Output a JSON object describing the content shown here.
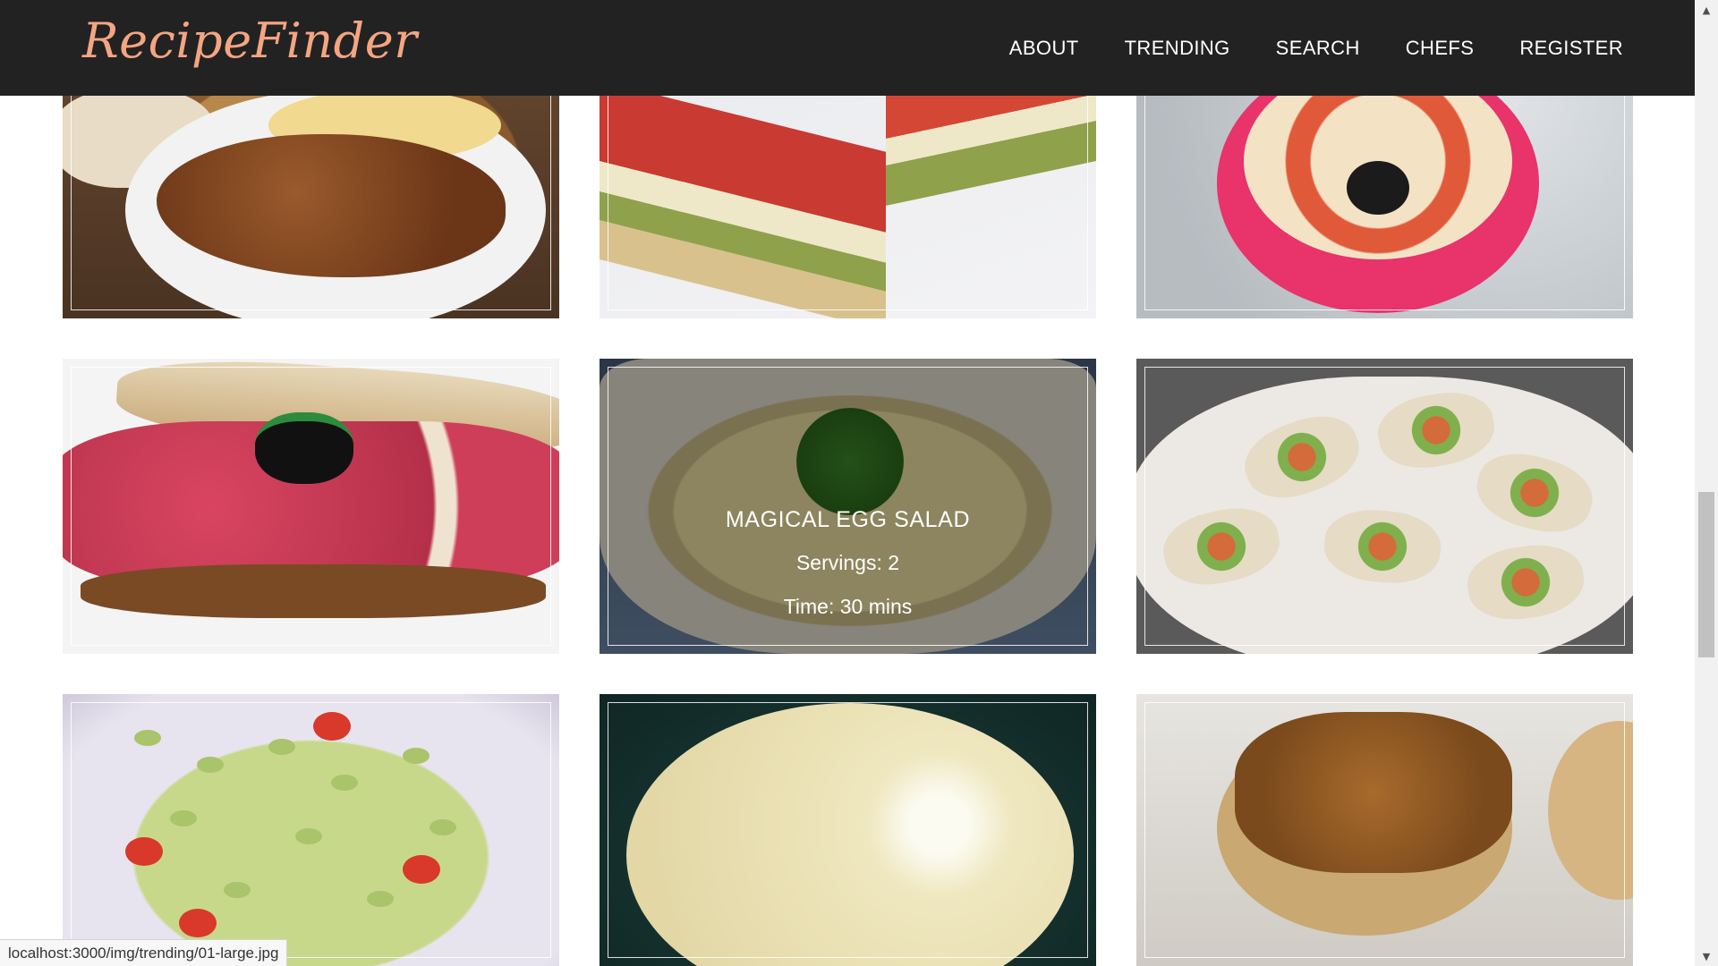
{
  "navbar": {
    "brand": "RecipeFinder",
    "links": [
      "ABOUT",
      "TRENDING",
      "SEARCH",
      "CHEFS",
      "REGISTER"
    ]
  },
  "featured": {
    "title": "MAGICAL EGG SALAD",
    "servings": "Servings: 2",
    "time": "Time: 30 mins"
  },
  "status_bar": {
    "url": "localhost:3000/img/trending/01-large.jpg"
  },
  "colors": {
    "navbar_bg": "#222222",
    "brand": "#f4a582",
    "nav_text": "#ffffff"
  }
}
